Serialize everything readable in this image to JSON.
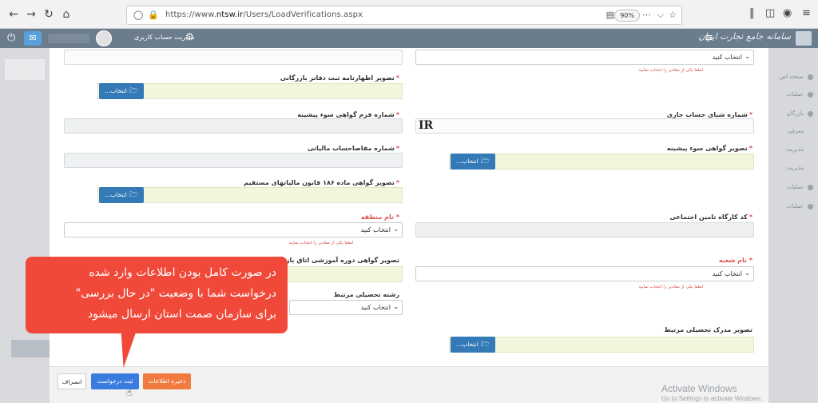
{
  "browser": {
    "url_prefix": "https://www.",
    "url_host": "ntsw.ir",
    "url_path": "/Users/LoadVerifications.aspx",
    "zoom": "90%"
  },
  "header": {
    "brand": "سامانه جامع تجارت ایران",
    "user_menu": "مدیریت حساب کاربری"
  },
  "sidebar_right": {
    "items": [
      "صفحه اص",
      "عملیات",
      "بازرگان",
      "معرفی",
      "مدیریت",
      "مدیریت",
      "عملیات",
      "عملیات"
    ]
  },
  "form": {
    "select_placeholder": "انتخاب کنید",
    "helper_text": "لطفا یکی از مقادیر را انتخاب نمایید",
    "browse_label": "انتخاب...",
    "labels": {
      "trade_card_image": "تصویر اظهارنامه ثبت دفاتر بازرگانی",
      "bank_account_sheba": "شماره شبای حساب جاری",
      "prev_good_conduct_form": "شماره فرم گواهی سوء پیشینه",
      "prev_good_conduct_image": "تصویر گواهی سوء پیشینه",
      "tax_settlement_no": "شماره مفاصاحساب مالیاتی",
      "article_186_image": "تصویر گواهی ماده ۱۸۶ قانون مالیاتهای مستقیم",
      "region_name": "نام منطقه",
      "social_security_code": "کد کارگاه تامین اجتماعی",
      "training_course_image": "تصویر گواهی دوره آموزشی اتاق بازرگانی",
      "branch_name": "نام شعبه",
      "related_field_of_study": "رشته تحصیلی مرتبط",
      "related_degree_image": "تصویر مدرک تحصیلی مرتبط"
    },
    "sheba_value": "IR"
  },
  "footer": {
    "save": "ذخیره اطلاعات",
    "submit": "ثبت درخواست",
    "cancel": "انصراف"
  },
  "callout": {
    "line1": "در صورت کامل بودن اطلاعات وارد شده",
    "line2": "درخواست شما با وضعیت \"در حال بررسی\"",
    "line3": "برای سازمان صمت استان  ارسال میشود"
  },
  "watermark": {
    "title": "Activate Windows",
    "subtitle": "Go to Settings to activate Windows."
  }
}
